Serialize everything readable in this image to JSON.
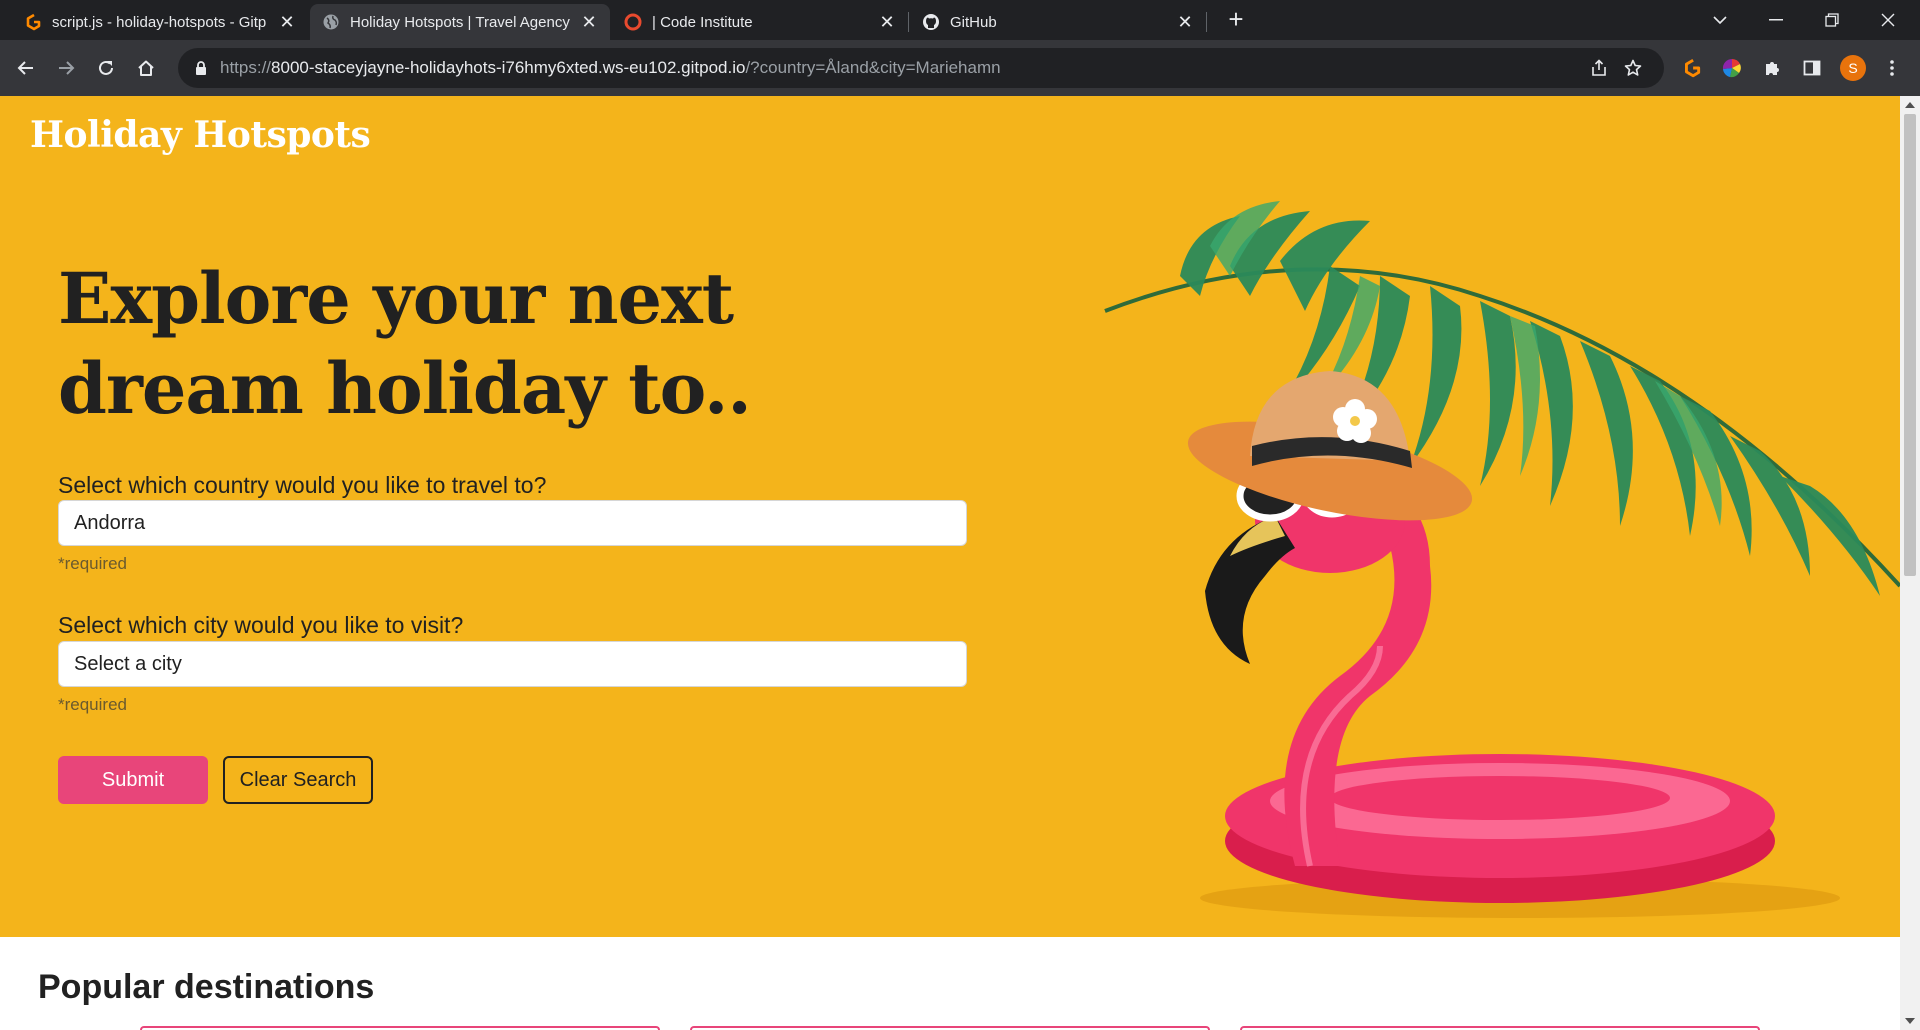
{
  "browser": {
    "tabs": [
      {
        "title": "script.js - holiday-hotspots - Gitp",
        "icon": "gitpod-icon"
      },
      {
        "title": "Holiday Hotspots | Travel Agency",
        "icon": "globe-icon"
      },
      {
        "title": "| Code Institute",
        "icon": "code-institute-icon"
      },
      {
        "title": "GitHub",
        "icon": "github-icon"
      }
    ],
    "url_scheme": "https://",
    "url_host": "8000-staceyjayne-holidayhots-i76hmy6xted.ws-eu102.gitpod.io",
    "url_path": "/?country=Åland&city=Mariehamn",
    "profile_initial": "S"
  },
  "page": {
    "brand": "Holiday Hotspots",
    "headline": "Explore your next dream holiday to..",
    "country_label": "Select which country would you like to travel to?",
    "country_value": "Andorra",
    "country_required": "*required",
    "city_label": "Select which city would you like to visit?",
    "city_value": "Select a city",
    "city_required": "*required",
    "submit_label": "Submit",
    "clear_label": "Clear Search",
    "popular_title": "Popular destinations"
  },
  "colors": {
    "hero_bg": "#f4b41b",
    "accent_pink": "#e8457a",
    "chrome_dark": "#202124"
  }
}
